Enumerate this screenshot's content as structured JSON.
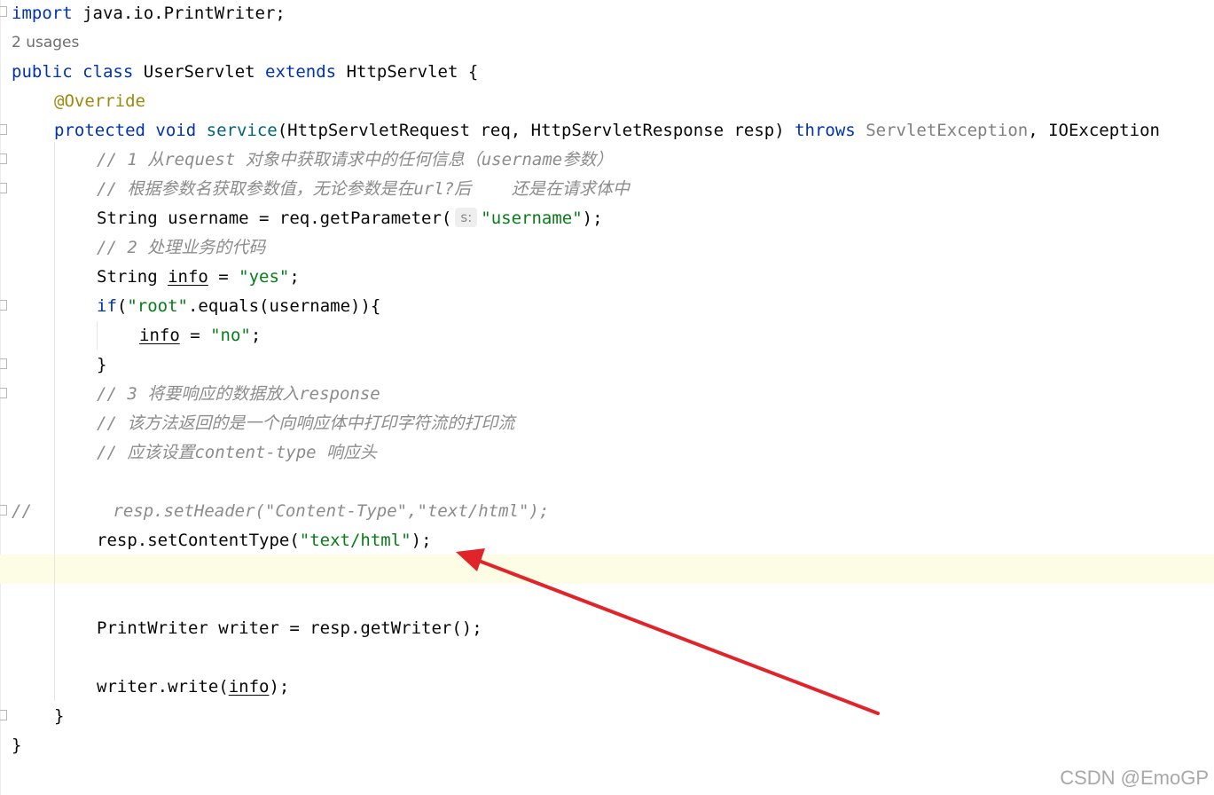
{
  "code": {
    "l1_kw": "import",
    "l1_rest": " java.io.PrintWriter;",
    "usages": "2 usages",
    "l3_kw_public": "public",
    "l3_kw_class": "class",
    "l3_name": "UserServlet",
    "l3_kw_extends": "extends",
    "l3_parent": "HttpServlet {",
    "annotation": "@Override",
    "l5_kw_protected": "protected",
    "l5_kw_void": "void",
    "l5_method": "service",
    "l5_params": "(HttpServletRequest req, HttpServletResponse resp)",
    "l5_kw_throws": "throws",
    "l5_exc1": "ServletException",
    "l5_exc2": ", IOException",
    "c1": "// 1 从request 对象中获取请求中的任何信息（username参数）",
    "c2": "// 根据参数名获取参数值，无论参数是在url?后    还是在请求体中",
    "l8_pre": "String username = req.getParameter(",
    "l8_hint": "s:",
    "l8_str": "\"username\"",
    "l8_post": ");",
    "c3": "// 2 处理业务的代码",
    "l10_pre": "String ",
    "l10_var": "info",
    "l10_mid": " = ",
    "l10_str": "\"yes\"",
    "l10_post": ";",
    "l11_kw": "if",
    "l11_open": "(",
    "l11_str": "\"root\"",
    "l11_rest": ".equals(username)){",
    "l12_var": "info",
    "l12_mid": " = ",
    "l12_str": "\"no\"",
    "l12_post": ";",
    "l13_brace": "}",
    "c4": "// 3 将要响应的数据放入response",
    "c5": "// 该方法返回的是一个向响应体中打印字符流的打印流",
    "c6": "// 应该设置content-type 响应头",
    "c7": "//        resp.setHeader(\"Content-Type\",\"text/html\");",
    "l18_pre": "resp.setContentType(",
    "l18_str": "\"text/html\"",
    "l18_post": ");",
    "l21": "PrintWriter writer = resp.getWriter();",
    "l23_pre": "writer.write(",
    "l23_var": "info",
    "l23_post": ");",
    "l24_brace": "}",
    "l25_brace": "}"
  },
  "annotation_arrow": {
    "color": "#e0242a"
  },
  "watermark": "CSDN @EmoGP"
}
